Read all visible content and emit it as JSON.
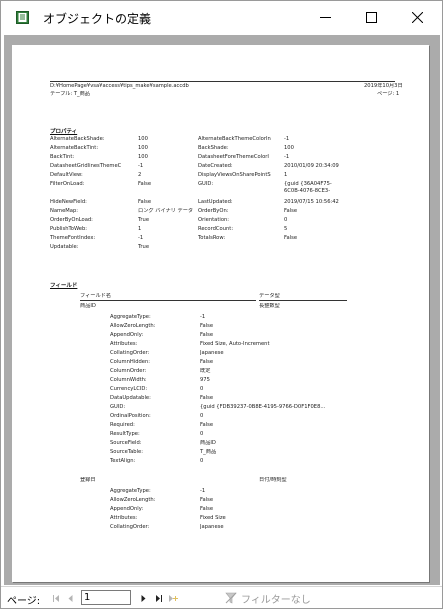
{
  "window": {
    "title": "オブジェクトの定義"
  },
  "report": {
    "path": "D:¥HomePage¥vsa¥access¥tips_make¥sample.accdb",
    "date": "2019年10月3日",
    "table_label": "テーブル: T_商品",
    "page_label": "ページ: 1",
    "props_heading": "プロパティ",
    "props": [
      {
        "name": "AlternateBackShade:",
        "value": "100"
      },
      {
        "name": "AlternateBackThemeColorIn",
        "value": "-1"
      },
      {
        "name": "AlternateBackTint:",
        "value": "100"
      },
      {
        "name": "BackShade:",
        "value": "100"
      },
      {
        "name": "BackTint:",
        "value": "100"
      },
      {
        "name": "DatasheetForeThemeColorI",
        "value": "-1"
      },
      {
        "name": "DatasheetGridlinesThemeC",
        "value": "-1"
      },
      {
        "name": "DateCreated:",
        "value": "2010/01/09 20:34:09"
      },
      {
        "name": "DefaultView:",
        "value": "2"
      },
      {
        "name": "DisplayViewsOnSharePointS",
        "value": "1"
      },
      {
        "name": "FilterOnLoad:",
        "value": "False"
      },
      {
        "name": "GUID:",
        "value": "{guid {36A04F75-6C0B-4076-8CE3-DC518C..."
      },
      {
        "name": "HideNewField:",
        "value": "False"
      },
      {
        "name": "LastUpdated:",
        "value": "2019/07/15 10:56:42"
      },
      {
        "name": "NameMap:",
        "value": "ロング バイナリ データ"
      },
      {
        "name": "OrderByOn:",
        "value": "False"
      },
      {
        "name": "OrderByOnLoad:",
        "value": "True"
      },
      {
        "name": "Orientation:",
        "value": "0"
      },
      {
        "name": "PublishToWeb:",
        "value": "1"
      },
      {
        "name": "RecordCount:",
        "value": "5"
      },
      {
        "name": "ThemeFontIndex:",
        "value": "-1"
      },
      {
        "name": "TotalsRow:",
        "value": "False"
      },
      {
        "name": "Updatable:",
        "value": "True"
      }
    ],
    "fields_heading": "フィールド",
    "col_field": "フィールド名",
    "col_type": "データ型",
    "field1": {
      "name": "商品ID",
      "type": "長整数型",
      "props": [
        {
          "name": "AggregateType:",
          "value": "-1"
        },
        {
          "name": "AllowZeroLength:",
          "value": "False"
        },
        {
          "name": "AppendOnly:",
          "value": "False"
        },
        {
          "name": "Attributes:",
          "value": "Fixed Size, Auto-Increment"
        },
        {
          "name": "CollatingOrder:",
          "value": "Japanese"
        },
        {
          "name": "ColumnHidden:",
          "value": "False"
        },
        {
          "name": "ColumnOrder:",
          "value": "既定"
        },
        {
          "name": "ColumnWidth:",
          "value": "975"
        },
        {
          "name": "CurrencyLCID:",
          "value": "0"
        },
        {
          "name": "DataUpdatable:",
          "value": "False"
        },
        {
          "name": "GUID:",
          "value": "{guid {FDB39237-0B8E-4195-9766-D0F1F0E8..."
        },
        {
          "name": "OrdinalPosition:",
          "value": "0"
        },
        {
          "name": "Required:",
          "value": "False"
        },
        {
          "name": "ResultType:",
          "value": "0"
        },
        {
          "name": "SourceField:",
          "value": "商品ID"
        },
        {
          "name": "SourceTable:",
          "value": "T_商品"
        },
        {
          "name": "TextAlign:",
          "value": "0"
        }
      ]
    },
    "field2": {
      "name": "登録日",
      "type": "日付/時刻型",
      "props": [
        {
          "name": "AggregateType:",
          "value": "-1"
        },
        {
          "name": "AllowZeroLength:",
          "value": "False"
        },
        {
          "name": "AppendOnly:",
          "value": "False"
        },
        {
          "name": "Attributes:",
          "value": "Fixed Size"
        },
        {
          "name": "CollatingOrder:",
          "value": "Japanese"
        }
      ]
    }
  },
  "statusbar": {
    "page_label": "ページ:",
    "page_value": "1",
    "filter_label": "フィルターなし"
  }
}
